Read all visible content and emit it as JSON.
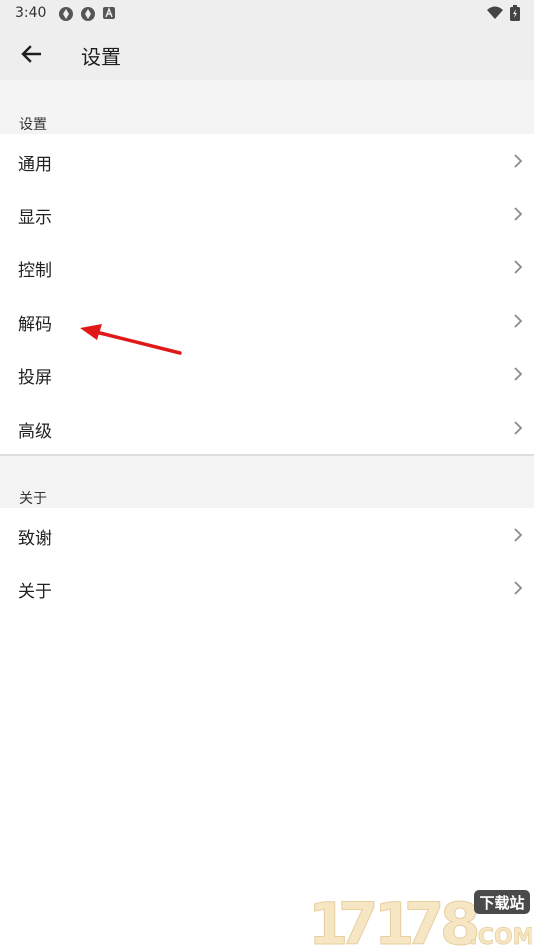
{
  "status": {
    "time": "3:40",
    "left_icons": [
      "sync-icon",
      "sync-icon",
      "font-icon"
    ],
    "right_icons": [
      "wifi-icon",
      "battery-icon"
    ]
  },
  "appbar": {
    "back_icon": "arrow-left-icon",
    "title": "设置"
  },
  "sections": [
    {
      "header": "设置",
      "items": [
        {
          "label": "通用"
        },
        {
          "label": "显示"
        },
        {
          "label": "控制"
        },
        {
          "label": "解码"
        },
        {
          "label": "投屏"
        },
        {
          "label": "高级"
        }
      ]
    },
    {
      "header": "关于",
      "items": [
        {
          "label": "致谢"
        },
        {
          "label": "关于"
        }
      ]
    }
  ],
  "annotation": {
    "color": "#e01818"
  },
  "watermark": {
    "digits": "17178",
    "badge": "下载站",
    "domain": "COM"
  },
  "colors": {
    "bar_bg": "#eeeeee",
    "chevron": "#8a8a8a"
  }
}
